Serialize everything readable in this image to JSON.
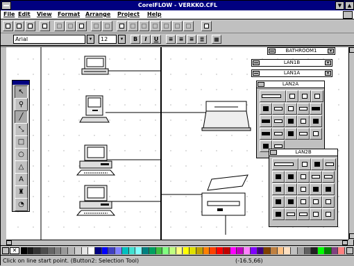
{
  "window": {
    "title": "CorelFLOW - VERKKO.CFL",
    "minimize_glyph": "▼",
    "maximize_glyph": "▲"
  },
  "menu": [
    "File",
    "Edit",
    "View",
    "Format",
    "Arrange",
    "Project",
    "Help"
  ],
  "font_bar": {
    "font_name": "Arial",
    "font_size": "12",
    "bold_label": "B",
    "italic_label": "I",
    "underline_label": "U"
  },
  "toolbox": {
    "tools": [
      {
        "name": "pick-tool",
        "glyph": "↖"
      },
      {
        "name": "zoom-tool",
        "glyph": "⚲"
      },
      {
        "name": "line-tool",
        "glyph": "╱"
      },
      {
        "name": "connector-tool",
        "glyph": "⤡"
      },
      {
        "name": "rectangle-tool",
        "glyph": "□"
      },
      {
        "name": "ellipse-tool",
        "glyph": "○"
      },
      {
        "name": "polygon-tool",
        "glyph": "△"
      },
      {
        "name": "text-tool",
        "glyph": "A"
      },
      {
        "name": "fill-tool",
        "glyph": "♜"
      },
      {
        "name": "outline-tool",
        "glyph": "◔"
      }
    ]
  },
  "panels": {
    "bathroom": "BATHROOM1",
    "lan1b": "LAN1B",
    "lan1a": "LAN1A",
    "lan2a": "LAN2A",
    "lan2b": "LAN2B"
  },
  "status": {
    "hint": "Click on line start point. (Button2: Selection Tool)",
    "coords": "(-16.5,66)"
  },
  "colors": {
    "title_bar": "#000080",
    "palette": [
      "#000000",
      "#1a1a1a",
      "#333333",
      "#4d4d4d",
      "#666666",
      "#808080",
      "#999999",
      "#b3b3b3",
      "#cccccc",
      "#e6e6e6",
      "#ffffff",
      "#000080",
      "#0000ff",
      "#4040c0",
      "#8080ff",
      "#00c0c0",
      "#40e0d0",
      "#80ffff",
      "#008080",
      "#00a060",
      "#40c040",
      "#80ff80",
      "#c0ff80",
      "#ffff80",
      "#ffff00",
      "#e0e000",
      "#c0a000",
      "#ff8000",
      "#ff4000",
      "#ff0000",
      "#c00000",
      "#ff00ff",
      "#c000c0",
      "#ff80ff",
      "#8000ff",
      "#400080",
      "#804000",
      "#c08040",
      "#ffc080",
      "#ffe0c0",
      "#c0c0c0",
      "#a0a0a0",
      "#606060",
      "#202020",
      "#00ff00",
      "#008000",
      "#804080",
      "#ff8080"
    ]
  }
}
